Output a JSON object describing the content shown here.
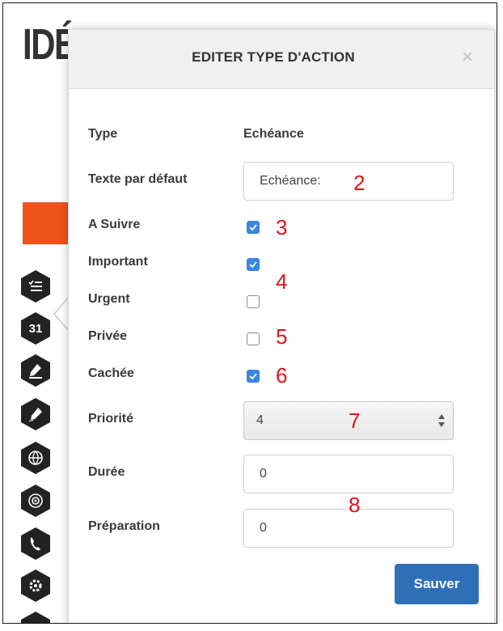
{
  "background": {
    "title": "IDÉ",
    "sidebar_icons": [
      "checklist-icon",
      "calendar-31-icon",
      "pen-sign-icon",
      "pen-draw-icon",
      "globe-icon",
      "target-icon",
      "phone-icon",
      "gear-people-icon",
      "document-icon"
    ],
    "calendar_icon_text": "31",
    "accent_color": "#f0521c"
  },
  "modal": {
    "title": "EDITER TYPE D'ACTION",
    "close_glyph": "×",
    "fields": {
      "type": {
        "label": "Type",
        "value": "Echéance"
      },
      "default_text": {
        "label": "Texte par défaut",
        "value": "Echéance:"
      },
      "a_suivre": {
        "label": "A Suivre",
        "checked": true
      },
      "important": {
        "label": "Important",
        "checked": true
      },
      "urgent": {
        "label": "Urgent",
        "checked": false
      },
      "privee": {
        "label": "Privée",
        "checked": false
      },
      "cachee": {
        "label": "Cachée",
        "checked": true
      },
      "priorite": {
        "label": "Priorité",
        "value": "4"
      },
      "duree": {
        "label": "Durée",
        "value": "0"
      },
      "preparation": {
        "label": "Préparation",
        "value": "0"
      }
    },
    "save_label": "Sauver",
    "primary_color": "#2f6fb5",
    "checkbox_color": "#3b86e0"
  },
  "annotations": [
    "2",
    "3",
    "4",
    "5",
    "6",
    "7",
    "8"
  ],
  "annotation_color": "#e0141c"
}
